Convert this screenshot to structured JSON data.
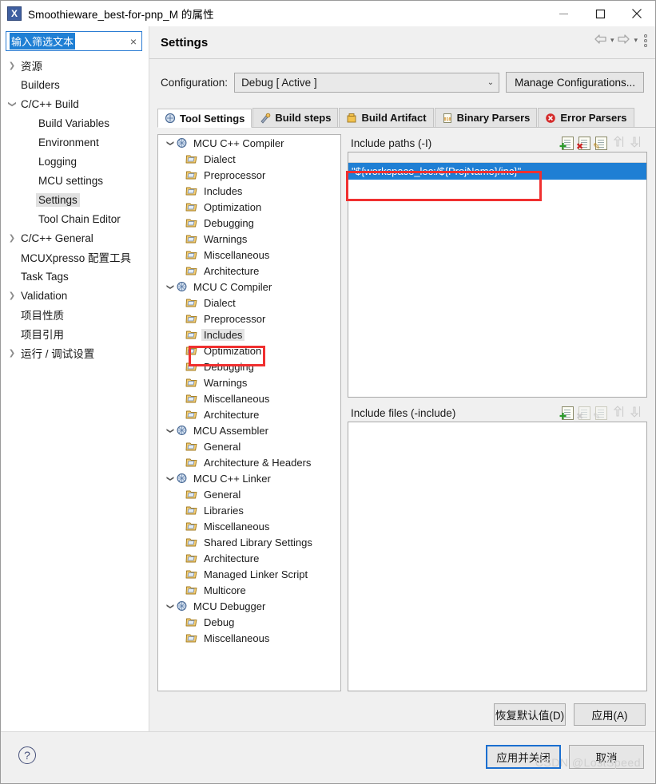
{
  "window": {
    "title": "Smoothieware_best-for-pnp_M 的属性",
    "app_icon": "X",
    "minimize": "minimize-icon",
    "maximize": "maximize-icon",
    "close": "close-icon"
  },
  "filter": {
    "value": "输入筛选文本",
    "clear_label": "×"
  },
  "sidebar": {
    "items": [
      {
        "label": "资源",
        "indent": 0,
        "arrow": "collapsed",
        "selected": false
      },
      {
        "label": "Builders",
        "indent": 0,
        "arrow": "none",
        "selected": false
      },
      {
        "label": "C/C++ Build",
        "indent": 0,
        "arrow": "expanded",
        "selected": false
      },
      {
        "label": "Build Variables",
        "indent": 1,
        "arrow": "none",
        "selected": false
      },
      {
        "label": "Environment",
        "indent": 1,
        "arrow": "none",
        "selected": false
      },
      {
        "label": "Logging",
        "indent": 1,
        "arrow": "none",
        "selected": false
      },
      {
        "label": "MCU settings",
        "indent": 1,
        "arrow": "none",
        "selected": false
      },
      {
        "label": "Settings",
        "indent": 1,
        "arrow": "none",
        "selected": true
      },
      {
        "label": "Tool Chain Editor",
        "indent": 1,
        "arrow": "none",
        "selected": false
      },
      {
        "label": "C/C++ General",
        "indent": 0,
        "arrow": "collapsed",
        "selected": false
      },
      {
        "label": "MCUXpresso 配置工具",
        "indent": 0,
        "arrow": "none",
        "selected": false
      },
      {
        "label": "Task Tags",
        "indent": 0,
        "arrow": "none",
        "selected": false
      },
      {
        "label": "Validation",
        "indent": 0,
        "arrow": "collapsed",
        "selected": false
      },
      {
        "label": "项目性质",
        "indent": 0,
        "arrow": "none",
        "selected": false
      },
      {
        "label": "项目引用",
        "indent": 0,
        "arrow": "none",
        "selected": false
      },
      {
        "label": "运行 / 调试设置",
        "indent": 0,
        "arrow": "collapsed",
        "selected": false
      }
    ]
  },
  "page": {
    "title": "Settings",
    "nav": {
      "back": "back-arrow-icon",
      "forward": "forward-arrow-icon",
      "menu": "view-menu-icon"
    }
  },
  "configuration": {
    "label": "Configuration:",
    "value": "Debug  [ Active ]",
    "manage_button": "Manage Configurations..."
  },
  "tabs": [
    {
      "label": "Tool Settings",
      "icon": "tool-settings-icon",
      "active": true
    },
    {
      "label": "Build steps",
      "icon": "build-steps-icon",
      "active": false
    },
    {
      "label": "Build Artifact",
      "icon": "build-artifact-icon",
      "active": false
    },
    {
      "label": "Binary Parsers",
      "icon": "binary-parsers-icon",
      "active": false
    },
    {
      "label": "Error Parsers",
      "icon": "error-parsers-icon",
      "active": false
    }
  ],
  "tools_tree": [
    {
      "label": "MCU C++ Compiler",
      "level": 0,
      "arrow": "expanded",
      "icon": "tool-icon",
      "highlight": false
    },
    {
      "label": "Dialect",
      "level": 1,
      "arrow": "none",
      "icon": "folder-icon",
      "highlight": false
    },
    {
      "label": "Preprocessor",
      "level": 1,
      "arrow": "none",
      "icon": "folder-icon",
      "highlight": false
    },
    {
      "label": "Includes",
      "level": 1,
      "arrow": "none",
      "icon": "folder-icon",
      "highlight": false
    },
    {
      "label": "Optimization",
      "level": 1,
      "arrow": "none",
      "icon": "folder-icon",
      "highlight": false
    },
    {
      "label": "Debugging",
      "level": 1,
      "arrow": "none",
      "icon": "folder-icon",
      "highlight": false
    },
    {
      "label": "Warnings",
      "level": 1,
      "arrow": "none",
      "icon": "folder-icon",
      "highlight": false
    },
    {
      "label": "Miscellaneous",
      "level": 1,
      "arrow": "none",
      "icon": "folder-icon",
      "highlight": false
    },
    {
      "label": "Architecture",
      "level": 1,
      "arrow": "none",
      "icon": "folder-icon",
      "highlight": false
    },
    {
      "label": "MCU C Compiler",
      "level": 0,
      "arrow": "expanded",
      "icon": "tool-icon",
      "highlight": false
    },
    {
      "label": "Dialect",
      "level": 1,
      "arrow": "none",
      "icon": "folder-icon",
      "highlight": false
    },
    {
      "label": "Preprocessor",
      "level": 1,
      "arrow": "none",
      "icon": "folder-icon",
      "highlight": false
    },
    {
      "label": "Includes",
      "level": 1,
      "arrow": "none",
      "icon": "folder-icon",
      "highlight": true
    },
    {
      "label": "Optimization",
      "level": 1,
      "arrow": "none",
      "icon": "folder-icon",
      "highlight": false
    },
    {
      "label": "Debugging",
      "level": 1,
      "arrow": "none",
      "icon": "folder-icon",
      "highlight": false
    },
    {
      "label": "Warnings",
      "level": 1,
      "arrow": "none",
      "icon": "folder-icon",
      "highlight": false
    },
    {
      "label": "Miscellaneous",
      "level": 1,
      "arrow": "none",
      "icon": "folder-icon",
      "highlight": false
    },
    {
      "label": "Architecture",
      "level": 1,
      "arrow": "none",
      "icon": "folder-icon",
      "highlight": false
    },
    {
      "label": "MCU Assembler",
      "level": 0,
      "arrow": "expanded",
      "icon": "tool-icon",
      "highlight": false
    },
    {
      "label": "General",
      "level": 1,
      "arrow": "none",
      "icon": "folder-icon",
      "highlight": false
    },
    {
      "label": "Architecture & Headers",
      "level": 1,
      "arrow": "none",
      "icon": "folder-icon",
      "highlight": false
    },
    {
      "label": "MCU C++ Linker",
      "level": 0,
      "arrow": "expanded",
      "icon": "tool-icon",
      "highlight": false
    },
    {
      "label": "General",
      "level": 1,
      "arrow": "none",
      "icon": "folder-icon",
      "highlight": false
    },
    {
      "label": "Libraries",
      "level": 1,
      "arrow": "none",
      "icon": "folder-icon",
      "highlight": false
    },
    {
      "label": "Miscellaneous",
      "level": 1,
      "arrow": "none",
      "icon": "folder-icon",
      "highlight": false
    },
    {
      "label": "Shared Library Settings",
      "level": 1,
      "arrow": "none",
      "icon": "folder-icon",
      "highlight": false
    },
    {
      "label": "Architecture",
      "level": 1,
      "arrow": "none",
      "icon": "folder-icon",
      "highlight": false
    },
    {
      "label": "Managed Linker Script",
      "level": 1,
      "arrow": "none",
      "icon": "folder-icon",
      "highlight": false
    },
    {
      "label": "Multicore",
      "level": 1,
      "arrow": "none",
      "icon": "folder-icon",
      "highlight": false
    },
    {
      "label": "MCU Debugger",
      "level": 0,
      "arrow": "expanded",
      "icon": "tool-icon",
      "highlight": false
    },
    {
      "label": "Debug",
      "level": 1,
      "arrow": "none",
      "icon": "folder-icon",
      "highlight": false
    },
    {
      "label": "Miscellaneous",
      "level": 1,
      "arrow": "none",
      "icon": "folder-icon",
      "highlight": false
    }
  ],
  "include_paths": {
    "title": "Include paths (-I)",
    "entries": [
      "\"${workspace_loc:/${ProjName}/inc}\""
    ],
    "toolbar": [
      {
        "name": "add-include-path-icon",
        "enabled": true
      },
      {
        "name": "delete-include-path-icon",
        "enabled": true
      },
      {
        "name": "edit-include-path-icon",
        "enabled": true
      },
      {
        "name": "move-up-icon",
        "enabled": false
      },
      {
        "name": "move-down-icon",
        "enabled": false
      }
    ]
  },
  "include_files": {
    "title": "Include files (-include)",
    "entries": [],
    "toolbar": [
      {
        "name": "add-include-file-icon",
        "enabled": true
      },
      {
        "name": "delete-include-file-icon",
        "enabled": false
      },
      {
        "name": "edit-include-file-icon",
        "enabled": false
      },
      {
        "name": "move-up-icon",
        "enabled": false
      },
      {
        "name": "move-down-icon",
        "enabled": false
      }
    ]
  },
  "actions": {
    "restore_defaults": "恢复默认值(D)",
    "apply": "应用(A)",
    "apply_and_close": "应用并关闭",
    "cancel": "取消",
    "help": "?"
  },
  "watermark": "CSDN @LostSpeed",
  "colors": {
    "selection_blue": "#1f7fd4",
    "annotation_red": "#f03030",
    "annotation_blue": "#1a6fd0",
    "panel_bg": "#f0f0f0"
  }
}
